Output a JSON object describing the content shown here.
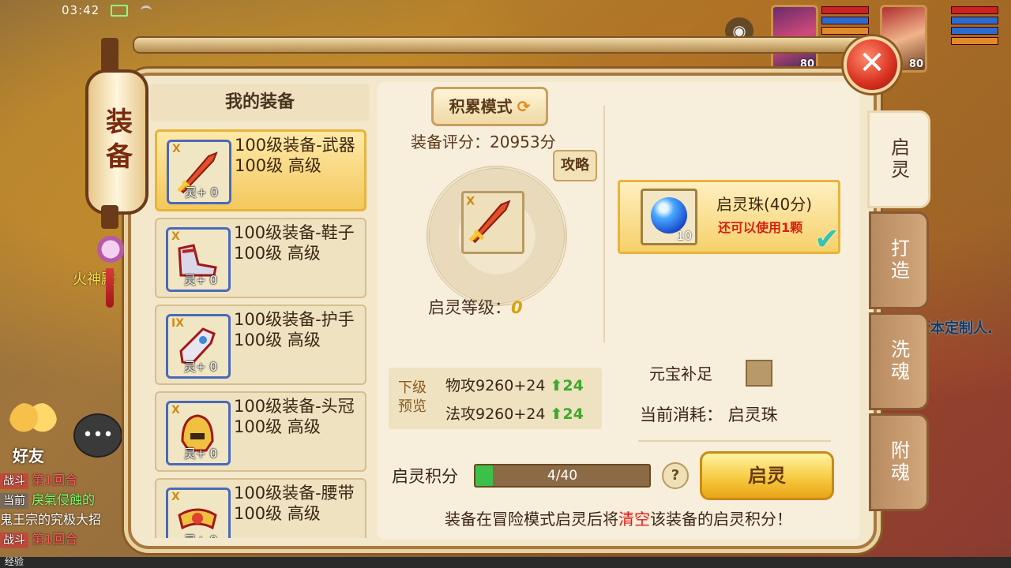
{
  "status": {
    "time": "03:42"
  },
  "player": {
    "level1": "80",
    "level2": "80"
  },
  "scene": {
    "npc_name": "火神殿",
    "side_text": "版本定制人."
  },
  "lantern": {
    "label": "装备"
  },
  "chat": {
    "friend_label": "好友",
    "lines": [
      {
        "tag": "战斗",
        "text": "第1回合"
      },
      {
        "tag": "当前",
        "text": "戾氣侵蝕的"
      },
      {
        "tag": "",
        "text": "鬼王宗的究极大招"
      },
      {
        "tag": "战斗",
        "text": "第1回合"
      }
    ],
    "exp_label": "经验"
  },
  "left_panel": {
    "header": "我的装备",
    "items": [
      {
        "rank": "X",
        "ling": "灵+ 0",
        "name": "100级装备-武器",
        "level": "100级 高级",
        "icon": "sword-icon"
      },
      {
        "rank": "X",
        "ling": "灵+ 0",
        "name": "100级装备-鞋子",
        "level": "100级 高级",
        "icon": "boots-icon"
      },
      {
        "rank": "IX",
        "ling": "灵+ 0",
        "name": "100级装备-护手",
        "level": "100级 高级",
        "icon": "gauntlet-icon"
      },
      {
        "rank": "X",
        "ling": "灵+ 0",
        "name": "100级装备-头冠",
        "level": "100级 高级",
        "icon": "helmet-icon"
      },
      {
        "rank": "X",
        "ling": "灵+ 0",
        "name": "100级装备-腰带",
        "level": "100级 高级",
        "icon": "belt-icon"
      }
    ]
  },
  "center": {
    "mode_button": "积累模式",
    "score": "装备评分：20953分",
    "guide_button": "攻略",
    "level_label": "启灵等级：",
    "level_value": "0",
    "preview_title": "下级预览",
    "stats": [
      {
        "text": "物攻9260+24",
        "gain": "24"
      },
      {
        "text": "法攻9260+24",
        "gain": "24"
      }
    ],
    "gem": {
      "name": "启灵珠(40分)",
      "count": "10",
      "remain": "还可以使用1颗"
    },
    "fill_label": "元宝补足",
    "cost": "当前消耗：  启灵珠",
    "points_label": "启灵积分",
    "progress": {
      "text": "4/40",
      "fraction": 0.1
    },
    "help": "?",
    "action_button": "启灵",
    "notice_pre": "装备在冒险模式启灵后将",
    "notice_hl": "清空",
    "notice_post": "该装备的启灵积分！"
  },
  "tabs": [
    "启灵",
    "打造",
    "洗魂",
    "附魂"
  ],
  "colors": {
    "accent": "#f6c73a",
    "highlight": "#e01818",
    "gain": "#3caa2a"
  }
}
